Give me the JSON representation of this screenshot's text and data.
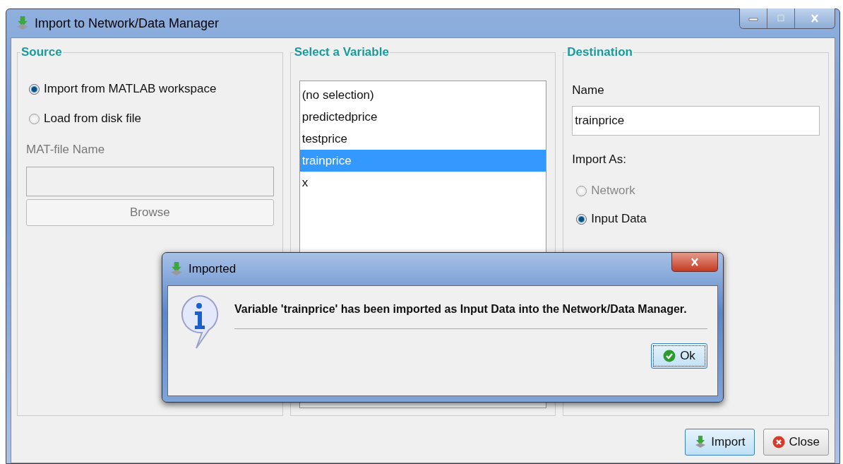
{
  "window": {
    "title": "Import to Network/Data Manager"
  },
  "source": {
    "title": "Source",
    "options": [
      {
        "label": "Import from MATLAB workspace",
        "selected": true
      },
      {
        "label": "Load from disk file",
        "selected": false
      }
    ],
    "file_label": "MAT-file Name",
    "file_disabled": true,
    "browse": {
      "label": "Browse",
      "disabled": true
    }
  },
  "variable": {
    "title": "Select a Variable",
    "items": [
      {
        "label": "(no selection)",
        "selected": false
      },
      {
        "label": "predictedprice",
        "selected": false
      },
      {
        "label": "testprice",
        "selected": false
      },
      {
        "label": "trainprice",
        "selected": true
      },
      {
        "label": "x",
        "selected": false
      }
    ]
  },
  "destination": {
    "title": "Destination",
    "name_label": "Name",
    "name_value": "trainprice",
    "import_as_label": "Import As:",
    "options": [
      {
        "label": "Network",
        "selected": false,
        "disabled": true
      },
      {
        "label": "Input Data",
        "selected": true,
        "disabled": false
      }
    ]
  },
  "buttons": [
    {
      "label": "Import",
      "kind": "import"
    },
    {
      "label": "Close",
      "kind": "close"
    }
  ],
  "dialog": {
    "title": "Imported",
    "message": "Variable 'trainprice' has been imported as Input Data into the Network/Data Manager.",
    "ok": "Ok"
  }
}
